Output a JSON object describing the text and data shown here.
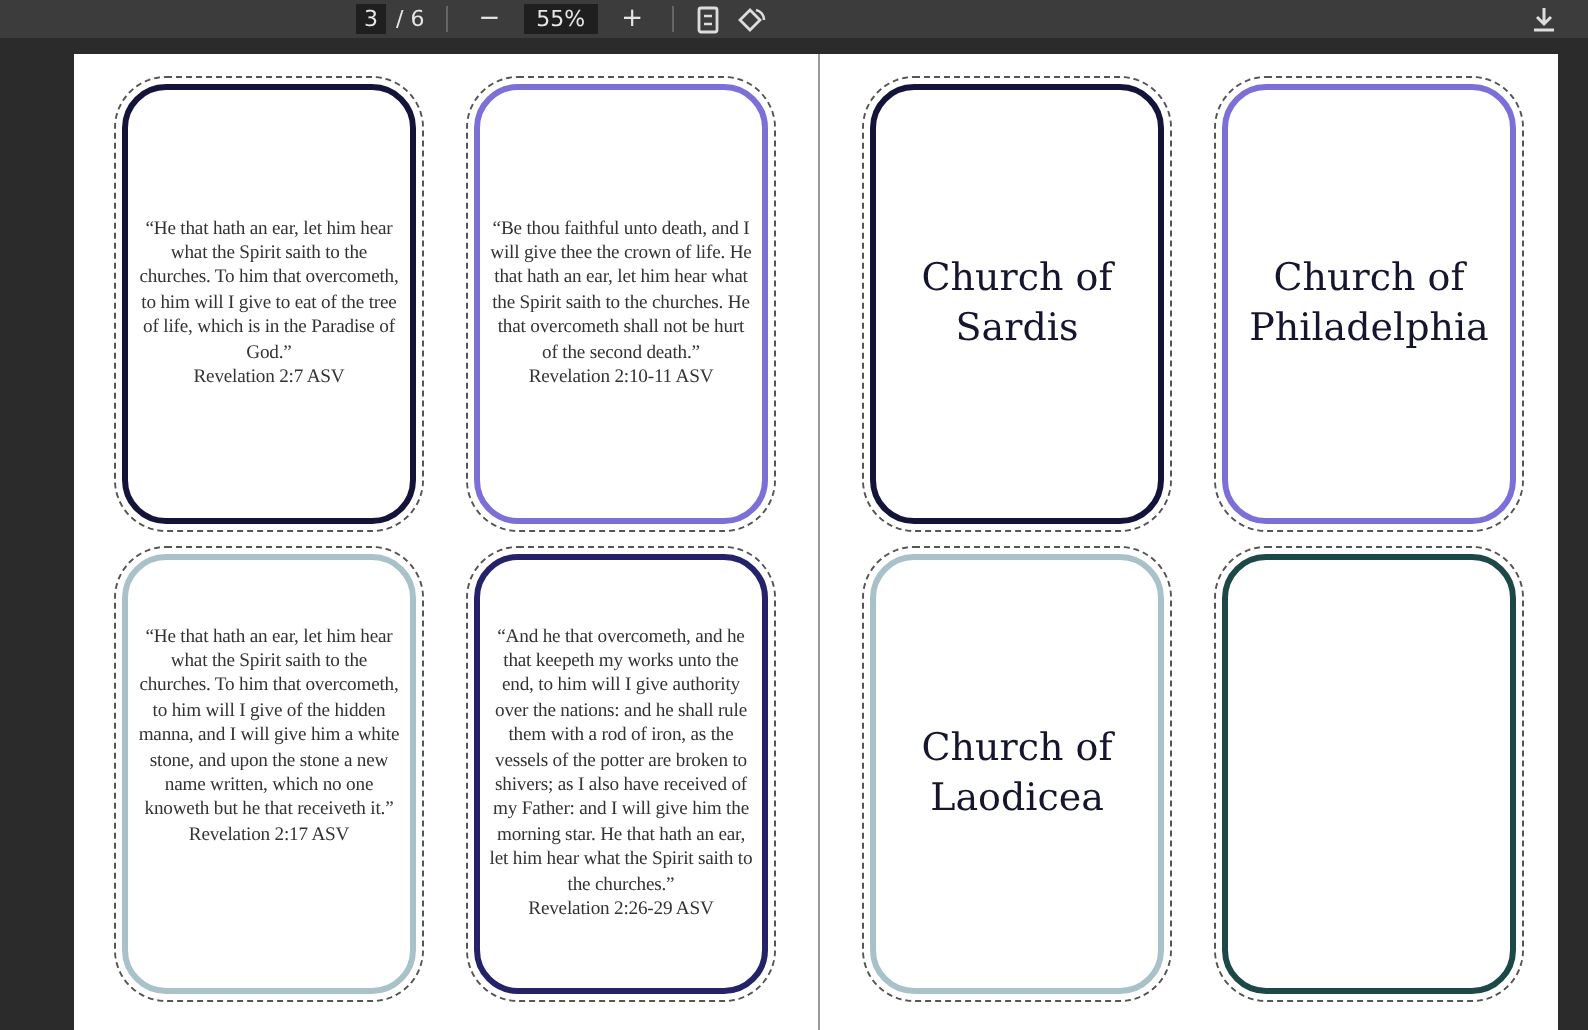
{
  "toolbar": {
    "page_number": "3",
    "page_total": "/ 6",
    "zoom_out": "−",
    "zoom": "55%",
    "zoom_in": "+"
  },
  "pages": [
    {
      "cards": [
        {
          "kind": "verse",
          "color": "#14143a",
          "text": "“He that hath an ear, let him hear what the Spirit saith to the churches. To him that overcometh, to him will I give to eat of the tree of life, which is in the Paradise of God.”\nRevelation 2:7 ASV"
        },
        {
          "kind": "verse",
          "color": "#7d6fd8",
          "text": "“Be thou faithful unto death, and I will give thee the crown of life. He that hath an ear, let him hear what the Spirit saith to the churches. He that overcometh shall not be hurt of the second death.”\nRevelation 2:10-11 ASV"
        },
        {
          "kind": "verse",
          "color": "#a9c1c9",
          "text": "“He that hath an ear, let him hear what the Spirit saith to the churches. To him that overcometh, to him will I give of the hidden manna, and I will give him a white stone, and upon the stone a new name written, which no one knoweth but he that receiveth it.” Revelation 2:17 ASV"
        },
        {
          "kind": "verse",
          "color": "#24236a",
          "text": "“And he that overcometh, and he that keepeth my works unto the end, to him will I give authority over the nations: and he shall rule them with a rod of iron, as the vessels of the potter are broken to shivers; as I also have received of my Father: and I will give him the morning star. He that hath an ear, let him hear what the Spirit saith to the churches.”\nRevelation 2:26-29 ASV"
        }
      ]
    },
    {
      "cards": [
        {
          "kind": "title",
          "color": "#14143a",
          "text": "Church of Sardis"
        },
        {
          "kind": "title",
          "color": "#7d6fd8",
          "text": "Church of Philadelphia"
        },
        {
          "kind": "title",
          "color": "#a9c1c9",
          "text": "Church of Laodicea"
        },
        {
          "kind": "blank",
          "color": "#1d4848"
        }
      ]
    }
  ]
}
